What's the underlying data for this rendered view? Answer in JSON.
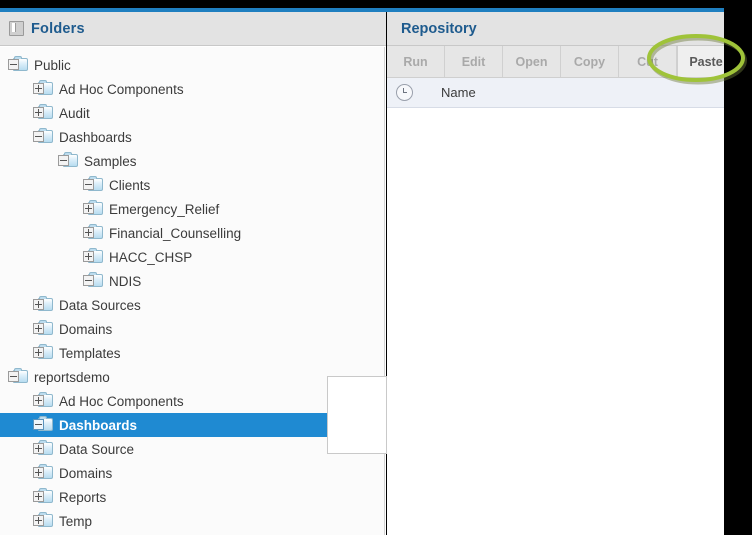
{
  "window": {
    "accent_blue": "#1f7fc0",
    "selection_blue": "#1f8ad2",
    "highlight_green": "#9fc339"
  },
  "folders_panel": {
    "title": "Folders",
    "collapse_icon": "panel-collapse-icon",
    "tree": [
      {
        "label": "Public",
        "depth": 0,
        "expander": "minus",
        "selected": false
      },
      {
        "label": "Ad Hoc Components",
        "depth": 1,
        "expander": "plus",
        "selected": false
      },
      {
        "label": "Audit",
        "depth": 1,
        "expander": "plus",
        "selected": false
      },
      {
        "label": "Dashboards",
        "depth": 1,
        "expander": "minus",
        "selected": false
      },
      {
        "label": "Samples",
        "depth": 2,
        "expander": "minus",
        "selected": false
      },
      {
        "label": "Clients",
        "depth": 3,
        "expander": "minus",
        "selected": false
      },
      {
        "label": "Emergency_Relief",
        "depth": 3,
        "expander": "plus",
        "selected": false
      },
      {
        "label": "Financial_Counselling",
        "depth": 3,
        "expander": "plus",
        "selected": false
      },
      {
        "label": "HACC_CHSP",
        "depth": 3,
        "expander": "plus",
        "selected": false
      },
      {
        "label": "NDIS",
        "depth": 3,
        "expander": "minus",
        "selected": false
      },
      {
        "label": "Data Sources",
        "depth": 1,
        "expander": "plus",
        "selected": false
      },
      {
        "label": "Domains",
        "depth": 1,
        "expander": "plus",
        "selected": false
      },
      {
        "label": "Templates",
        "depth": 1,
        "expander": "plus",
        "selected": false
      },
      {
        "label": "reportsdemo",
        "depth": 0,
        "expander": "minus",
        "selected": false
      },
      {
        "label": "Ad Hoc Components",
        "depth": 1,
        "expander": "plus",
        "selected": false
      },
      {
        "label": "Dashboards",
        "depth": 1,
        "expander": "minus",
        "selected": true
      },
      {
        "label": "Data Source",
        "depth": 1,
        "expander": "plus",
        "selected": false
      },
      {
        "label": "Domains",
        "depth": 1,
        "expander": "plus",
        "selected": false
      },
      {
        "label": "Reports",
        "depth": 1,
        "expander": "plus",
        "selected": false
      },
      {
        "label": "Temp",
        "depth": 1,
        "expander": "plus",
        "selected": false
      }
    ]
  },
  "repository_panel": {
    "title": "Repository",
    "toolbar": [
      {
        "label": "Run",
        "enabled": false
      },
      {
        "label": "Edit",
        "enabled": false
      },
      {
        "label": "Open",
        "enabled": false
      },
      {
        "label": "Copy",
        "enabled": false
      },
      {
        "label": "Cut",
        "enabled": false
      },
      {
        "label": "Paste",
        "enabled": true
      }
    ],
    "columns": {
      "clock_icon": "clock-icon",
      "name": "Name"
    },
    "rows": []
  }
}
